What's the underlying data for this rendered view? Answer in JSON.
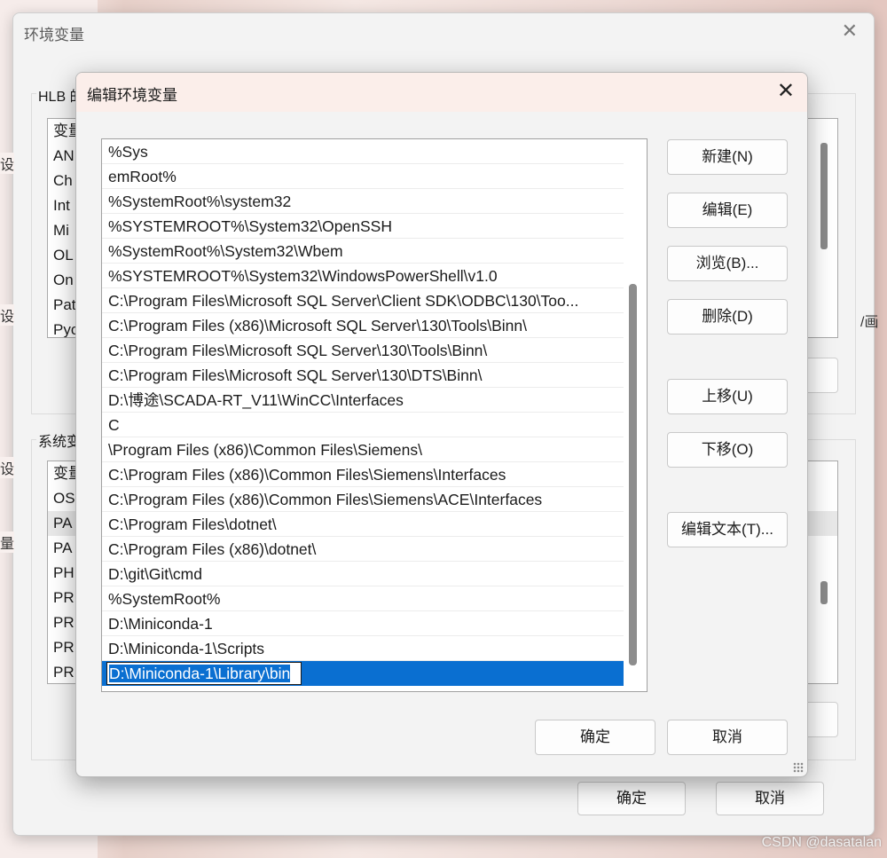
{
  "outer_dialog": {
    "title": "环境变量",
    "close_glyph": "✕",
    "user_group_label": "HLB 的",
    "user_list_header": "变量",
    "user_vars": [
      "AN",
      "Ch",
      "Int",
      "Mi",
      "OL",
      "On",
      "Pat",
      "Pyc"
    ],
    "system_group_label": "系统变",
    "system_list_header": "变量",
    "system_vars": [
      "OS",
      "PA",
      "PA",
      "PH",
      "PR",
      "PR",
      "PR",
      "PR"
    ],
    "ok_label": "确定",
    "cancel_label": "取消"
  },
  "left_fragments": [
    "设",
    "设",
    "设",
    "量"
  ],
  "right_fragment": "/画",
  "edit_dialog": {
    "title": "编辑环境变量",
    "close_glyph": "✕",
    "paths": [
      "%Sys",
      "emRoot%",
      "%SystemRoot%\\system32",
      "%SYSTEMROOT%\\System32\\OpenSSH",
      "%SystemRoot%\\System32\\Wbem",
      "%SYSTEMROOT%\\System32\\WindowsPowerShell\\v1.0",
      "C:\\Program Files\\Microsoft SQL Server\\Client SDK\\ODBC\\130\\Too...",
      "C:\\Program Files (x86)\\Microsoft SQL Server\\130\\Tools\\Binn\\",
      "C:\\Program Files\\Microsoft SQL Server\\130\\Tools\\Binn\\",
      "C:\\Program Files\\Microsoft SQL Server\\130\\DTS\\Binn\\",
      "D:\\博途\\SCADA-RT_V11\\WinCC\\Interfaces",
      "C",
      "\\Program Files (x86)\\Common Files\\Siemens\\",
      "C:\\Program Files (x86)\\Common Files\\Siemens\\Interfaces",
      "C:\\Program Files (x86)\\Common Files\\Siemens\\ACE\\Interfaces",
      "C:\\Program Files\\dotnet\\",
      "C:\\Program Files (x86)\\dotnet\\",
      "D:\\git\\Git\\cmd",
      "%SystemRoot%",
      "D:\\Miniconda-1",
      "D:\\Miniconda-1\\Scripts"
    ],
    "editing_value": "D:\\Miniconda-1\\Library\\bin",
    "buttons": {
      "new": "新建(N)",
      "edit": "编辑(E)",
      "browse": "浏览(B)...",
      "delete": "删除(D)",
      "move_up": "上移(U)",
      "move_down": "下移(O)",
      "edit_text": "编辑文本(T)..."
    },
    "ok_label": "确定",
    "cancel_label": "取消"
  },
  "watermark": "CSDN @dasatalan",
  "colors": {
    "selection": "#0a6fd1",
    "titlebar": "#fbeeea"
  }
}
